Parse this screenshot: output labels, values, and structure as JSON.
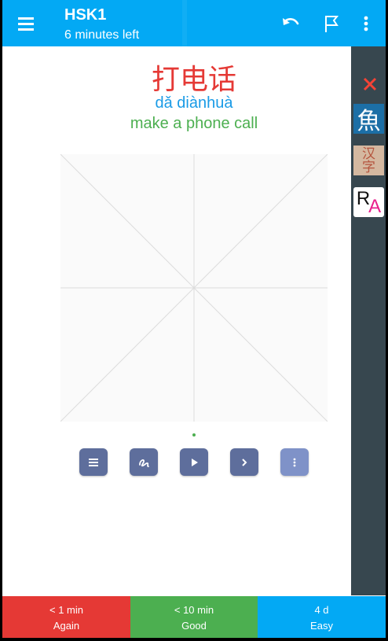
{
  "appbar": {
    "title": "HSK1",
    "subtitle": "6 minutes left",
    "icons": [
      "menu-icon",
      "undo-icon",
      "flag-icon",
      "more-vert-icon"
    ]
  },
  "card": {
    "hanzi": "打电话",
    "pinyin": "dǎ diànhuà",
    "meaning": "make a phone call",
    "colors": {
      "hanzi": "#e53935",
      "pinyin": "#1a9be6",
      "meaning": "#4caf50"
    }
  },
  "rail": {
    "fish_char": "魚",
    "hanzi_tile_top": "汉",
    "hanzi_tile_bottom": "字",
    "ra_r": "R",
    "ra_a": "A"
  },
  "toolbar": [
    "list-icon",
    "stroke-icon",
    "play-icon",
    "next-icon",
    "more-vert-icon"
  ],
  "answers": {
    "again": {
      "time": "< 1 min",
      "label": "Again",
      "color": "#e53935"
    },
    "good": {
      "time": "< 10 min",
      "label": "Good",
      "color": "#4caf50"
    },
    "easy": {
      "time": "4 d",
      "label": "Easy",
      "color": "#03a9f4"
    }
  }
}
